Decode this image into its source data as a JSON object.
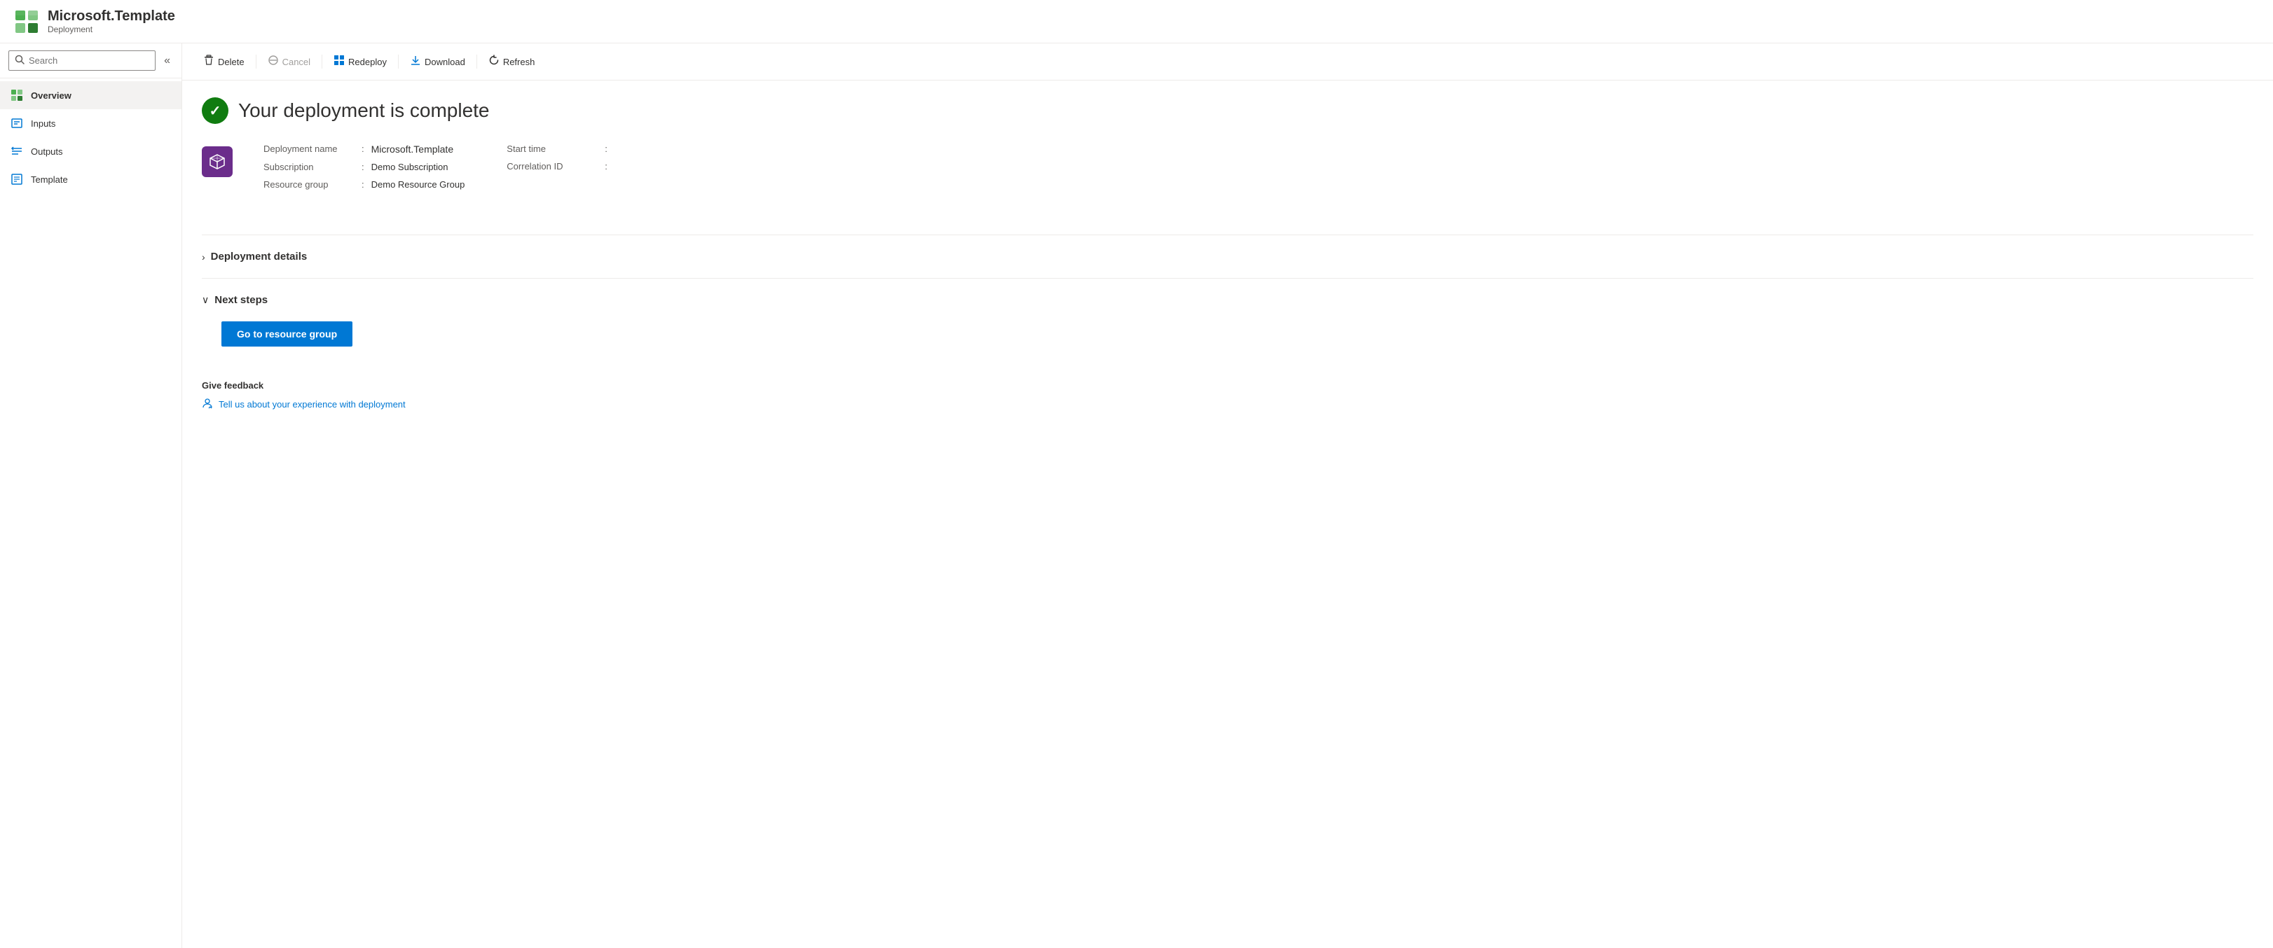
{
  "header": {
    "title": "Microsoft.Template",
    "subtitle": "Deployment"
  },
  "sidebar": {
    "search_placeholder": "Search",
    "collapse_label": "«",
    "nav_items": [
      {
        "id": "overview",
        "label": "Overview",
        "active": true,
        "icon": "cube-icon"
      },
      {
        "id": "inputs",
        "label": "Inputs",
        "active": false,
        "icon": "inputs-icon"
      },
      {
        "id": "outputs",
        "label": "Outputs",
        "active": false,
        "icon": "outputs-icon"
      },
      {
        "id": "template",
        "label": "Template",
        "active": false,
        "icon": "template-icon"
      }
    ]
  },
  "toolbar": {
    "buttons": [
      {
        "id": "delete",
        "label": "Delete",
        "icon": "🗑",
        "disabled": false
      },
      {
        "id": "cancel",
        "label": "Cancel",
        "icon": "⊘",
        "disabled": true
      },
      {
        "id": "redeploy",
        "label": "Redeploy",
        "icon": "⊞",
        "disabled": false
      },
      {
        "id": "download",
        "label": "Download",
        "icon": "⬇",
        "disabled": false
      },
      {
        "id": "refresh",
        "label": "Refresh",
        "icon": "↻",
        "disabled": false
      }
    ]
  },
  "main": {
    "deployment_complete_title": "Your deployment is complete",
    "deployment_info": {
      "name_label": "Deployment name",
      "name_value": "Microsoft.Template",
      "subscription_label": "Subscription",
      "subscription_value": "Demo Subscription",
      "resource_group_label": "Resource group",
      "resource_group_value": "Demo Resource Group",
      "start_time_label": "Start time",
      "start_time_value": "",
      "correlation_id_label": "Correlation ID",
      "correlation_id_value": ""
    },
    "deployment_details": {
      "title": "Deployment details",
      "expanded": false
    },
    "next_steps": {
      "title": "Next steps",
      "expanded": true,
      "go_to_resource_group_label": "Go to resource group"
    },
    "feedback": {
      "title": "Give feedback",
      "link_text": "Tell us about your experience with deployment"
    }
  }
}
